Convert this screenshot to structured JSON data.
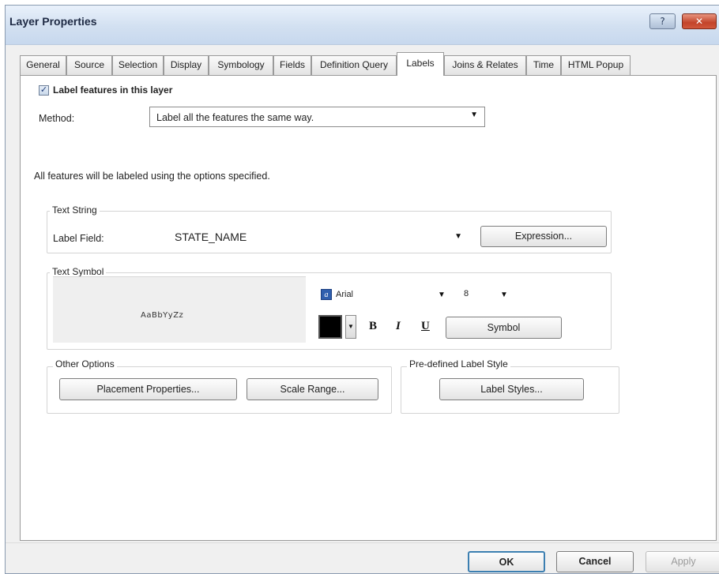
{
  "window": {
    "title": "Layer Properties",
    "help_glyph": "?",
    "close_glyph": "✕"
  },
  "tabs": [
    {
      "label": "General"
    },
    {
      "label": "Source"
    },
    {
      "label": "Selection"
    },
    {
      "label": "Display"
    },
    {
      "label": "Symbology"
    },
    {
      "label": "Fields"
    },
    {
      "label": "Definition Query"
    },
    {
      "label": "Labels",
      "active": true
    },
    {
      "label": "Joins & Relates"
    },
    {
      "label": "Time"
    },
    {
      "label": "HTML Popup"
    }
  ],
  "labels_tab": {
    "label_features_checkbox": {
      "label": "Label features in this layer",
      "checked": true,
      "mark": "✓"
    },
    "method": {
      "label": "Method:",
      "value": "Label all the features the same way."
    },
    "description": "All features will be labeled using the options specified.",
    "text_string": {
      "group_title": "Text String",
      "label_field_label": "Label Field:",
      "label_field_value": "STATE_NAME",
      "expression_button": "Expression..."
    },
    "text_symbol": {
      "group_title": "Text Symbol",
      "preview_text": "AaBbYyZz",
      "font_icon_glyph": "a",
      "font_name": "Arial",
      "font_size": "8",
      "bold_label": "B",
      "italic_label": "I",
      "underline_label": "U",
      "symbol_button": "Symbol"
    },
    "other_options": {
      "group_title": "Other Options",
      "placement_button": "Placement Properties...",
      "scale_range_button": "Scale Range..."
    },
    "predefined": {
      "group_title": "Pre-defined Label Style",
      "label_styles_button": "Label Styles..."
    }
  },
  "footer": {
    "ok": "OK",
    "cancel": "Cancel",
    "apply": "Apply"
  },
  "icons": {
    "dropdown": "▼"
  },
  "colors": {
    "active_checkbox": "#1f3c78",
    "title_bar": "#d2e0f1",
    "close": "#c2442a",
    "ok_focus": "#3c7fb1"
  }
}
